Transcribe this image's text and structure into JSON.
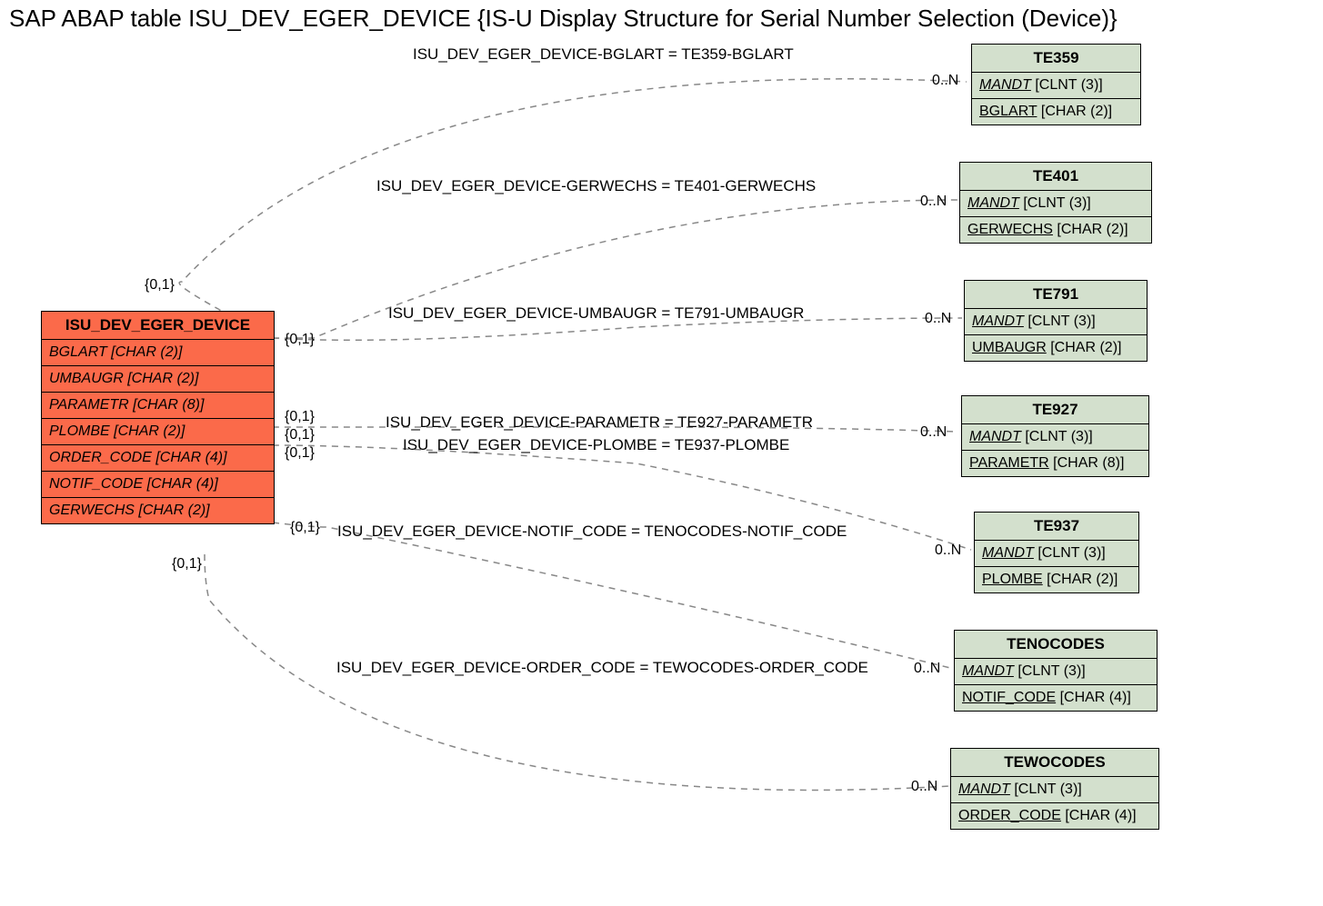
{
  "title": "SAP ABAP table ISU_DEV_EGER_DEVICE {IS-U Display Structure for Serial Number Selection (Device)}",
  "main": {
    "name": "ISU_DEV_EGER_DEVICE",
    "fields": [
      "BGLART [CHAR (2)]",
      "UMBAUGR [CHAR (2)]",
      "PARAMETR [CHAR (8)]",
      "PLOMBE [CHAR (2)]",
      "ORDER_CODE [CHAR (4)]",
      "NOTIF_CODE [CHAR (4)]",
      "GERWECHS [CHAR (2)]"
    ]
  },
  "targets": [
    {
      "name": "TE359",
      "key1": "MANDT",
      "key1type": "[CLNT (3)]",
      "key2": "BGLART",
      "key2type": "[CHAR (2)]"
    },
    {
      "name": "TE401",
      "key1": "MANDT",
      "key1type": "[CLNT (3)]",
      "key2": "GERWECHS",
      "key2type": "[CHAR (2)]"
    },
    {
      "name": "TE791",
      "key1": "MANDT",
      "key1type": "[CLNT (3)]",
      "key2": "UMBAUGR",
      "key2type": "[CHAR (2)]"
    },
    {
      "name": "TE927",
      "key1": "MANDT",
      "key1type": "[CLNT (3)]",
      "key2": "PARAMETR",
      "key2type": "[CHAR (8)]"
    },
    {
      "name": "TE937",
      "key1": "MANDT",
      "key1type": "[CLNT (3)]",
      "key2": "PLOMBE",
      "key2type": "[CHAR (2)]"
    },
    {
      "name": "TENOCODES",
      "key1": "MANDT",
      "key1type": "[CLNT (3)]",
      "key2": "NOTIF_CODE",
      "key2type": "[CHAR (4)]"
    },
    {
      "name": "TEWOCODES",
      "key1": "MANDT",
      "key1type": "[CLNT (3)]",
      "key2": "ORDER_CODE",
      "key2type": "[CHAR (4)]"
    }
  ],
  "relations": [
    "ISU_DEV_EGER_DEVICE-BGLART = TE359-BGLART",
    "ISU_DEV_EGER_DEVICE-GERWECHS = TE401-GERWECHS",
    "ISU_DEV_EGER_DEVICE-UMBAUGR = TE791-UMBAUGR",
    "ISU_DEV_EGER_DEVICE-PARAMETR = TE927-PARAMETR",
    "ISU_DEV_EGER_DEVICE-PLOMBE = TE937-PLOMBE",
    "ISU_DEV_EGER_DEVICE-NOTIF_CODE = TENOCODES-NOTIF_CODE",
    "ISU_DEV_EGER_DEVICE-ORDER_CODE = TEWOCODES-ORDER_CODE"
  ],
  "cardinality": {
    "source": "{0,1}",
    "target": "0..N"
  },
  "chart_data": {
    "type": "er-diagram",
    "entities": [
      {
        "name": "ISU_DEV_EGER_DEVICE",
        "role": "source",
        "fields": [
          "BGLART CHAR(2)",
          "UMBAUGR CHAR(2)",
          "PARAMETR CHAR(8)",
          "PLOMBE CHAR(2)",
          "ORDER_CODE CHAR(4)",
          "NOTIF_CODE CHAR(4)",
          "GERWECHS CHAR(2)"
        ]
      },
      {
        "name": "TE359",
        "role": "target",
        "fields": [
          "MANDT CLNT(3)",
          "BGLART CHAR(2)"
        ]
      },
      {
        "name": "TE401",
        "role": "target",
        "fields": [
          "MANDT CLNT(3)",
          "GERWECHS CHAR(2)"
        ]
      },
      {
        "name": "TE791",
        "role": "target",
        "fields": [
          "MANDT CLNT(3)",
          "UMBAUGR CHAR(2)"
        ]
      },
      {
        "name": "TE927",
        "role": "target",
        "fields": [
          "MANDT CLNT(3)",
          "PARAMETR CHAR(8)"
        ]
      },
      {
        "name": "TE937",
        "role": "target",
        "fields": [
          "MANDT CLNT(3)",
          "PLOMBE CHAR(2)"
        ]
      },
      {
        "name": "TENOCODES",
        "role": "target",
        "fields": [
          "MANDT CLNT(3)",
          "NOTIF_CODE CHAR(4)"
        ]
      },
      {
        "name": "TEWOCODES",
        "role": "target",
        "fields": [
          "MANDT CLNT(3)",
          "ORDER_CODE CHAR(4)"
        ]
      }
    ],
    "edges": [
      {
        "from": "ISU_DEV_EGER_DEVICE.BGLART",
        "to": "TE359.BGLART",
        "card_from": "0,1",
        "card_to": "0..N"
      },
      {
        "from": "ISU_DEV_EGER_DEVICE.GERWECHS",
        "to": "TE401.GERWECHS",
        "card_from": "0,1",
        "card_to": "0..N"
      },
      {
        "from": "ISU_DEV_EGER_DEVICE.UMBAUGR",
        "to": "TE791.UMBAUGR",
        "card_from": "0,1",
        "card_to": "0..N"
      },
      {
        "from": "ISU_DEV_EGER_DEVICE.PARAMETR",
        "to": "TE927.PARAMETR",
        "card_from": "0,1",
        "card_to": "0..N"
      },
      {
        "from": "ISU_DEV_EGER_DEVICE.PLOMBE",
        "to": "TE937.PLOMBE",
        "card_from": "0,1",
        "card_to": "0..N"
      },
      {
        "from": "ISU_DEV_EGER_DEVICE.NOTIF_CODE",
        "to": "TENOCODES.NOTIF_CODE",
        "card_from": "0,1",
        "card_to": "0..N"
      },
      {
        "from": "ISU_DEV_EGER_DEVICE.ORDER_CODE",
        "to": "TEWOCODES.ORDER_CODE",
        "card_from": "0,1",
        "card_to": "0..N"
      }
    ]
  }
}
